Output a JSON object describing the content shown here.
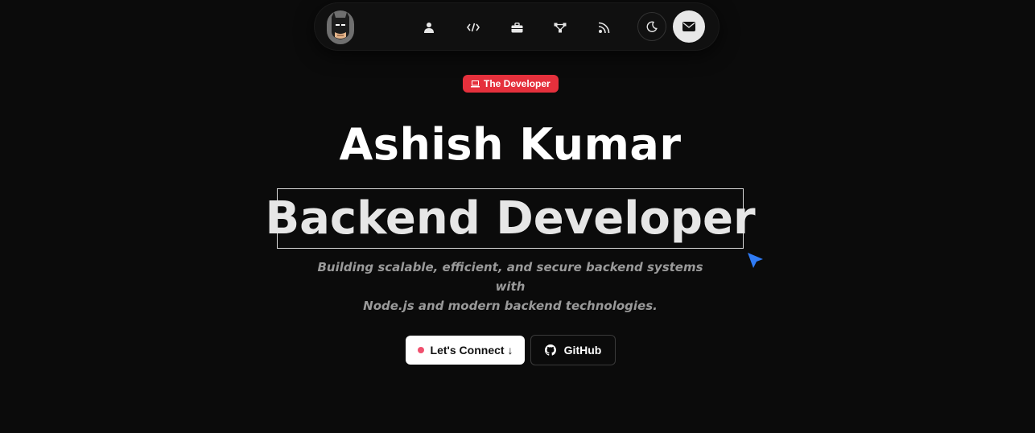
{
  "nav": {
    "avatar_icon": "batman-avatar-icon",
    "links": [
      {
        "name": "about",
        "icon": "user-icon"
      },
      {
        "name": "skills",
        "icon": "code-icon"
      },
      {
        "name": "experience",
        "icon": "briefcase-icon"
      },
      {
        "name": "projects",
        "icon": "network-icon"
      },
      {
        "name": "blog",
        "icon": "rss-icon"
      }
    ],
    "theme_icon": "moon-icon",
    "contact_icon": "envelope-icon"
  },
  "badge": {
    "icon": "laptop-icon",
    "label": "The Developer",
    "color": "#e5303c"
  },
  "hero": {
    "name": "Ashish Kumar",
    "role": "Backend Developer",
    "subtitle_line1": "Building scalable, efficient, and secure backend systems with",
    "subtitle_line2": "Node.js and modern backend technologies."
  },
  "cursor": {
    "icon": "pointer-cursor-icon",
    "color": "#2f7bf5"
  },
  "actions": {
    "connect_label": "Let's Connect ↓",
    "github_label": "GitHub",
    "github_icon": "github-icon",
    "dot_color": "#f0506e"
  }
}
